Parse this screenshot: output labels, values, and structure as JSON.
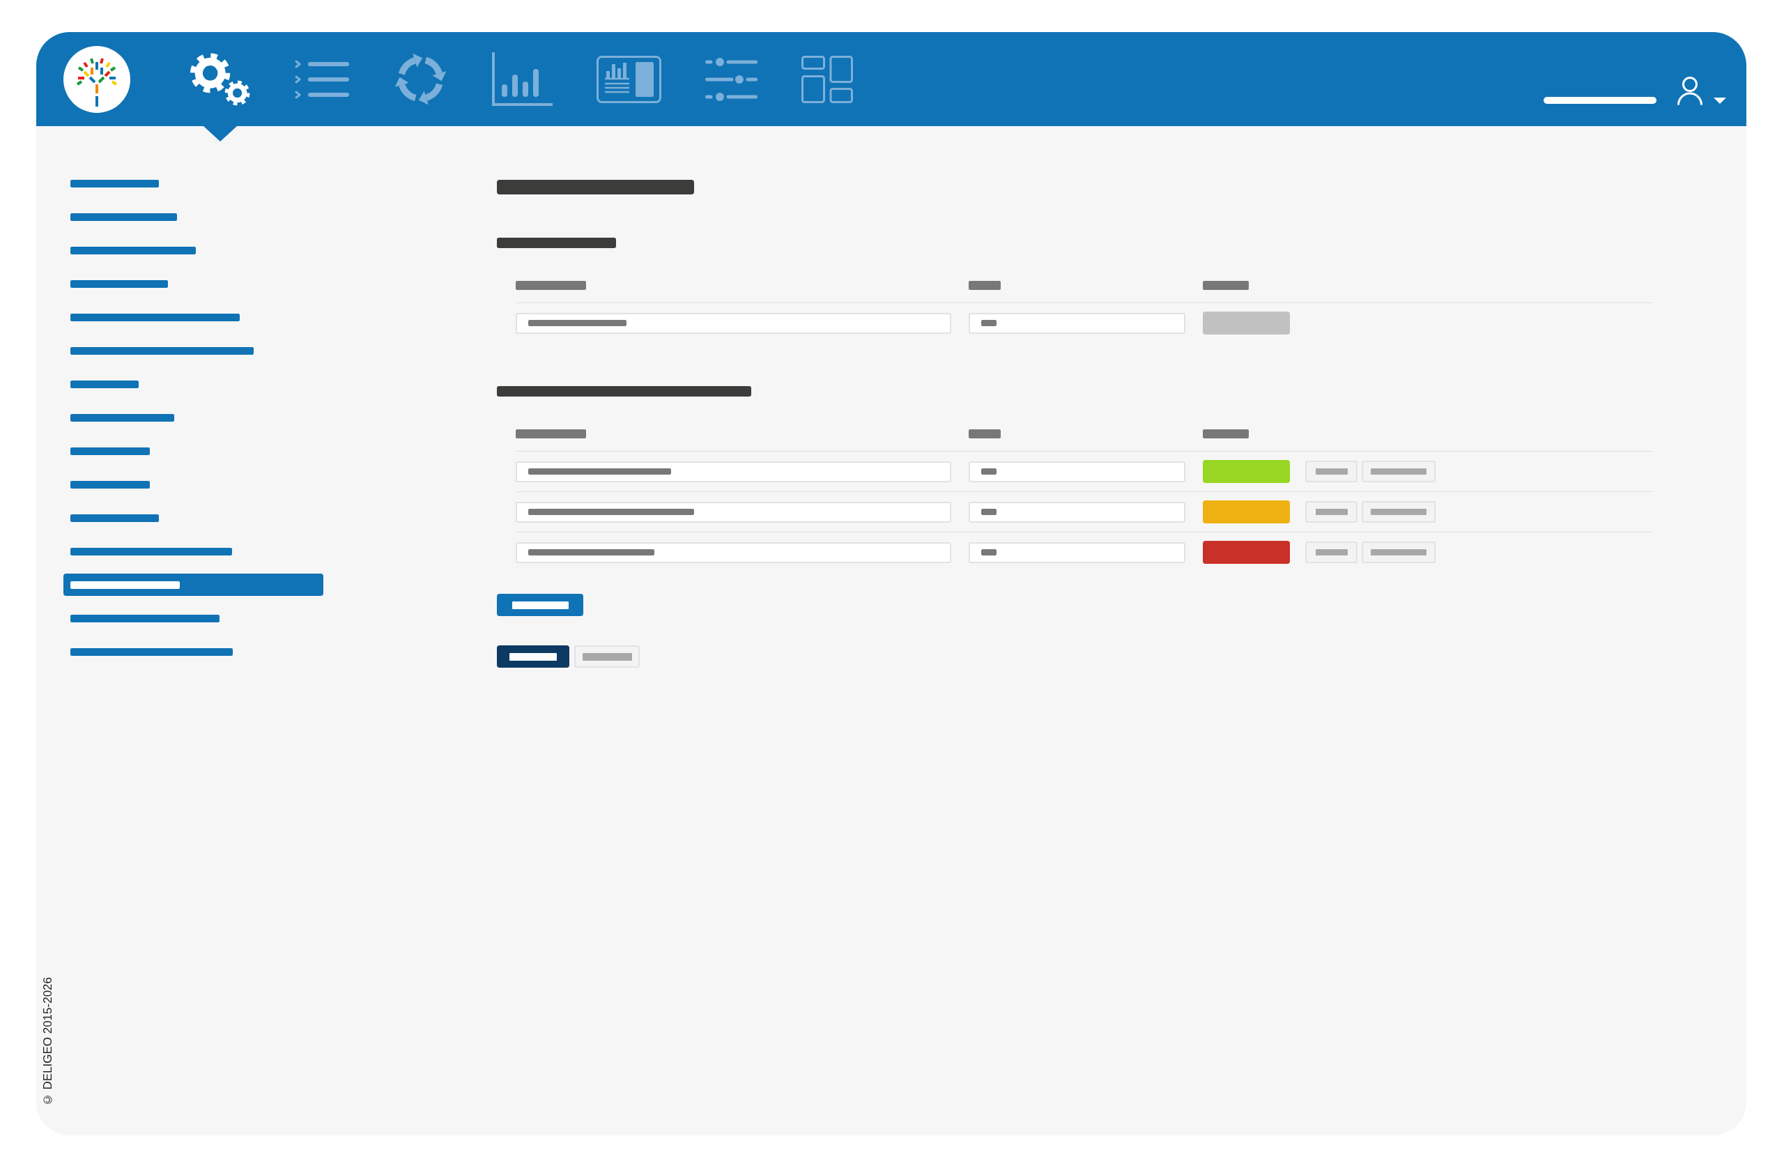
{
  "header": {
    "nav": [
      {
        "selected": true
      },
      {
        "selected": false
      },
      {
        "selected": false
      },
      {
        "selected": false
      },
      {
        "selected": false
      },
      {
        "selected": false
      },
      {
        "selected": false
      }
    ]
  },
  "sidebar": {
    "items": [
      {
        "selected": false
      },
      {
        "selected": false
      },
      {
        "selected": false
      },
      {
        "selected": false
      },
      {
        "selected": false
      },
      {
        "selected": false
      },
      {
        "selected": false
      },
      {
        "selected": false
      },
      {
        "selected": false
      },
      {
        "selected": false
      },
      {
        "selected": false
      },
      {
        "selected": false
      },
      {
        "selected": true
      },
      {
        "selected": false
      },
      {
        "selected": false
      }
    ]
  },
  "content": {
    "sections": [
      {
        "rows": [
          {
            "color": "#c1c1c1",
            "actions": false
          }
        ]
      },
      {
        "rows": [
          {
            "color": "#98d723",
            "actions": true
          },
          {
            "color": "#efb112",
            "actions": true
          },
          {
            "color": "#c93128",
            "actions": true
          }
        ]
      }
    ],
    "buttons": [
      {
        "kind": "accent"
      }
    ],
    "form_buttons": [
      {
        "kind": "primary"
      },
      {
        "kind": "secondary"
      }
    ]
  },
  "footer": {
    "copyright": "© DELIGEO 2015-2026"
  }
}
